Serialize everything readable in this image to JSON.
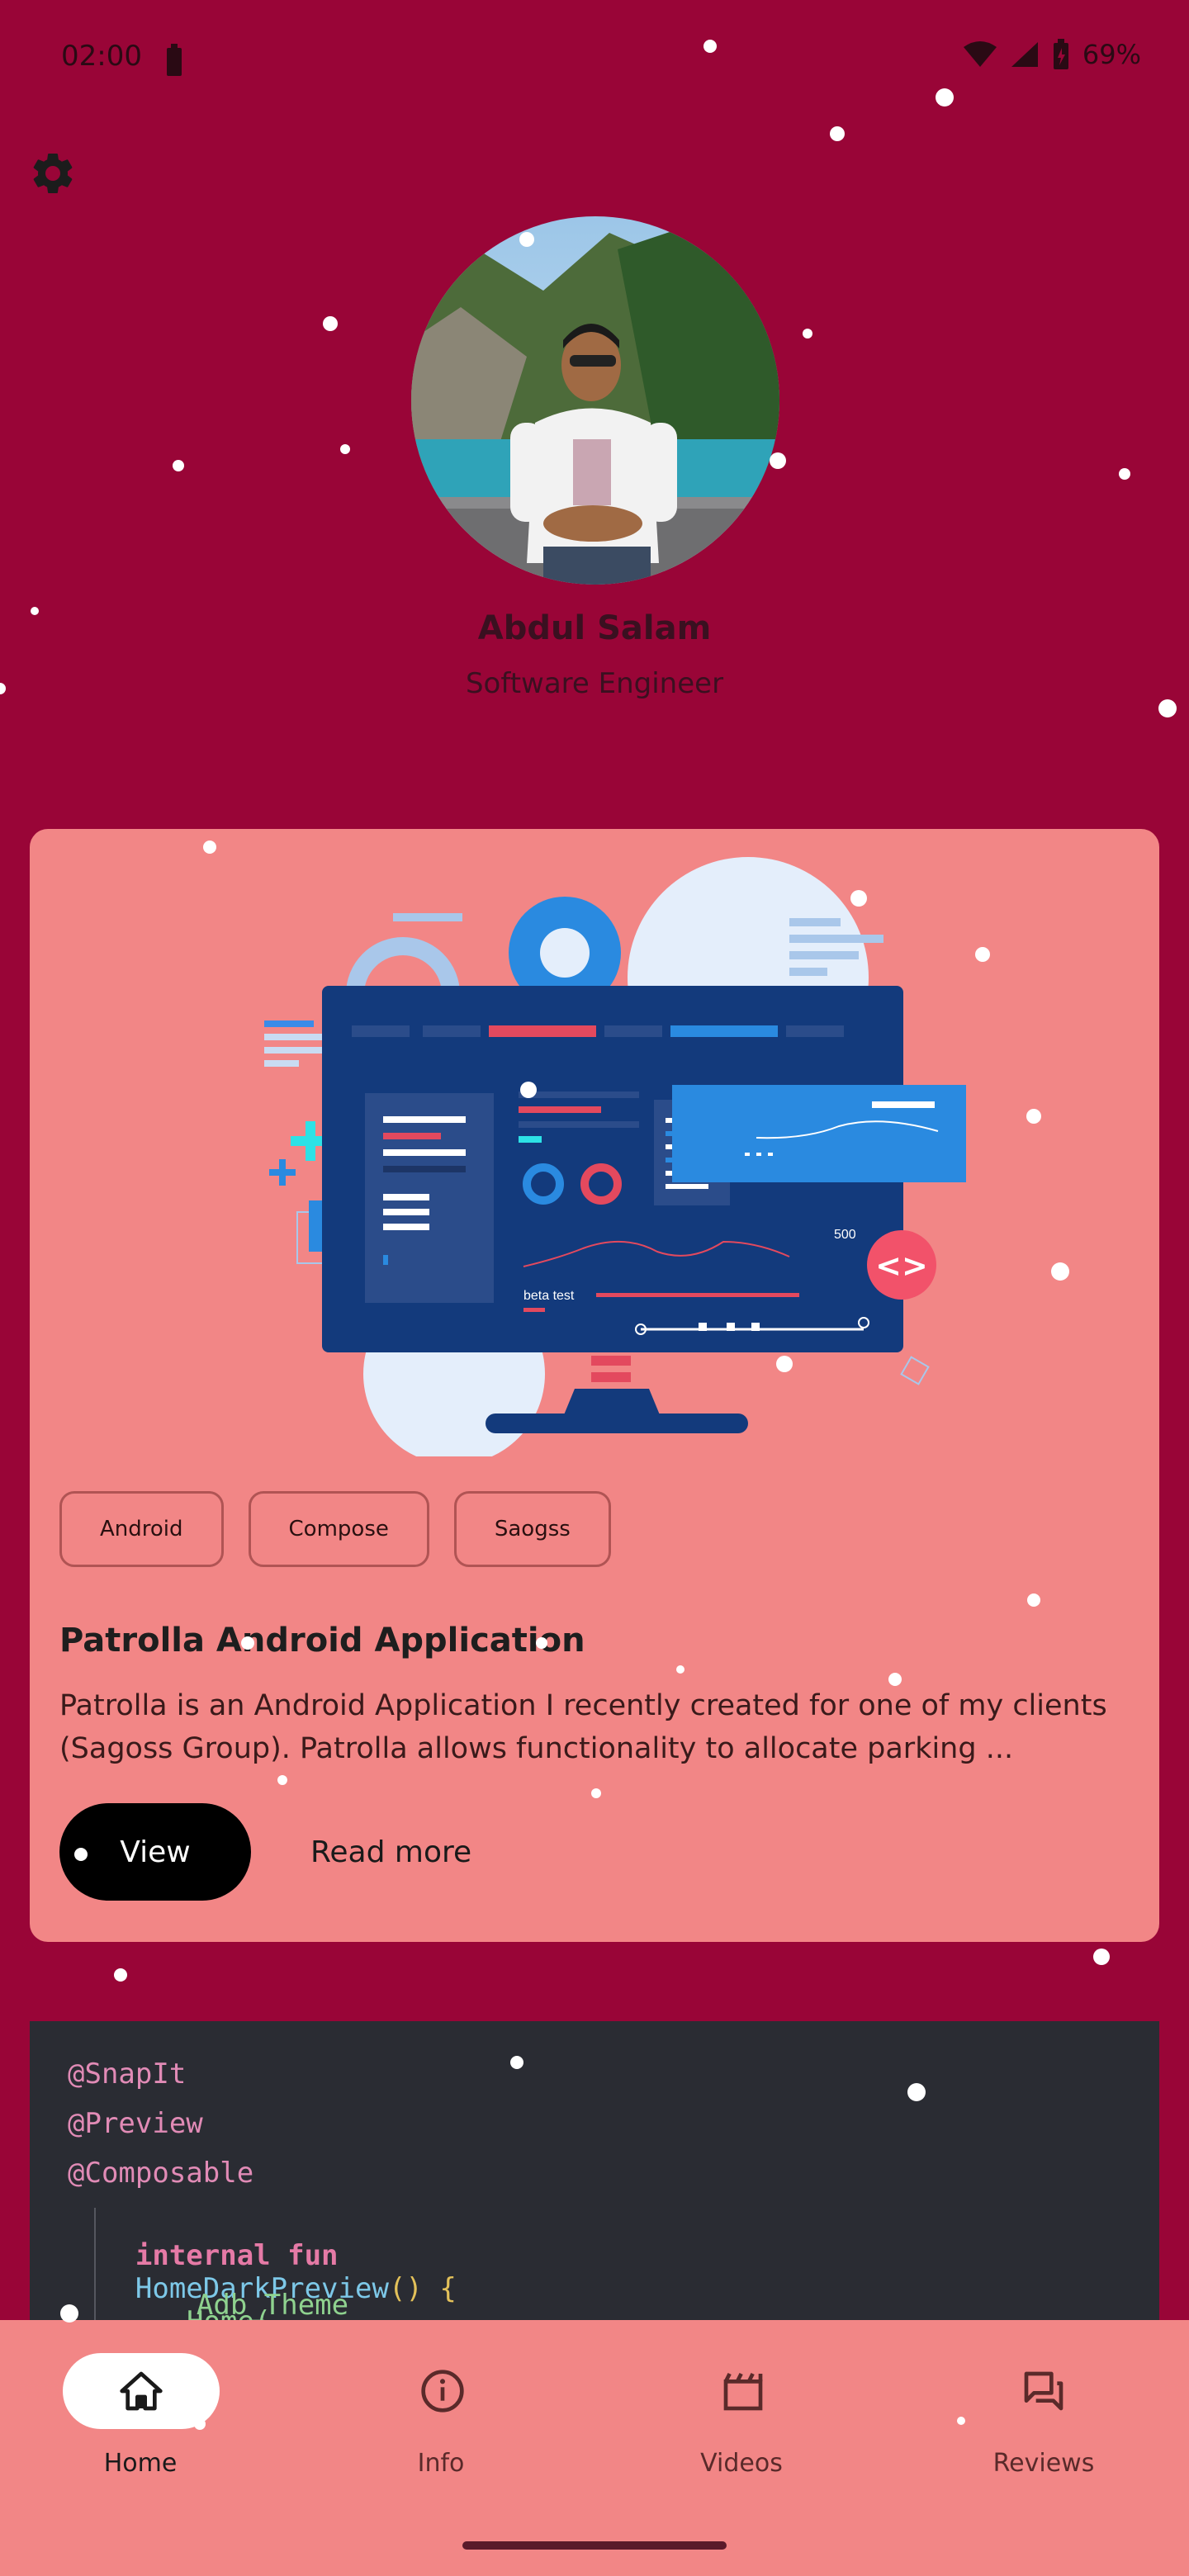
{
  "status_bar": {
    "time": "02:00",
    "battery": "69%"
  },
  "profile": {
    "name": "Abdul Salam",
    "title": "Software Engineer"
  },
  "project": {
    "chips": [
      "Android",
      "Compose",
      "Saogss"
    ],
    "title": "Patrolla Android Application",
    "description": "Patrolla is an Android Application I recently created for one of my clients (Sagoss Group). Patrolla allows functionality to allocate parking ...",
    "view_label": "View",
    "read_more_label": "Read more",
    "illustration": {
      "label": "beta test",
      "value": "500"
    }
  },
  "code_snippet": {
    "line1": "@SnapIt",
    "line2": "@Preview",
    "line3": "@Composable",
    "line4_kw": "internal fun",
    "line4_fn": "HomeDarkPreview",
    "line4_br": "() {",
    "line5_cls": "Adb_Theme",
    "line5_br": "{",
    "line6": "Home("
  },
  "nav": {
    "items": [
      {
        "label": "Home",
        "icon": "home-icon",
        "active": true
      },
      {
        "label": "Info",
        "icon": "info-icon",
        "active": false
      },
      {
        "label": "Videos",
        "icon": "videos-icon",
        "active": false
      },
      {
        "label": "Reviews",
        "icon": "reviews-icon",
        "active": false
      }
    ]
  },
  "colors": {
    "background": "#990537",
    "card": "#f28686",
    "code_bg": "#2a2c33",
    "nav_bg": "#f28686"
  }
}
